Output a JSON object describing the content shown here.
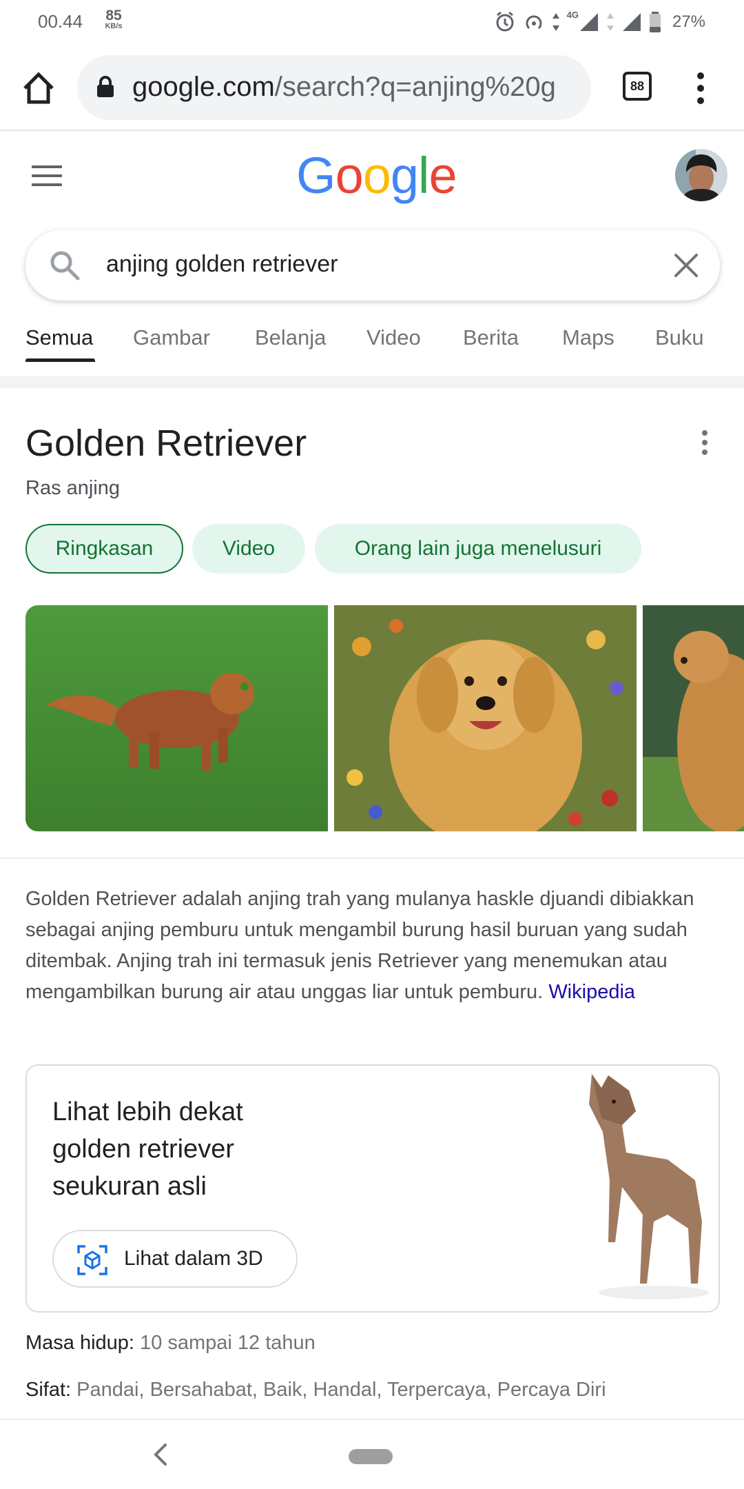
{
  "status_bar": {
    "time": "00.44",
    "speed_value": "85",
    "speed_unit": "KB/s",
    "network": "4G",
    "battery": "27%"
  },
  "browser": {
    "url_host": "google.com",
    "url_path": "/search?q=anjing%20g",
    "tab_count": "88"
  },
  "search": {
    "query": "anjing golden retriever",
    "tabs": [
      "Semua",
      "Gambar",
      "Belanja",
      "Video",
      "Berita",
      "Maps",
      "Buku"
    ],
    "active_tab": "Semua"
  },
  "knowledge_panel": {
    "title": "Golden Retriever",
    "subtitle": "Ras anjing",
    "chips": [
      "Ringkasan",
      "Video",
      "Orang lain juga menelusuri"
    ],
    "description": "Golden Retriever adalah anjing trah yang mulanya haskle djuandi dibiakkan sebagai anjing pemburu untuk mengambil burung hasil buruan yang sudah ditembak. Anjing trah ini termasuk jenis Retriever yang menemukan atau mengambilkan burung air atau unggas liar untuk pemburu.",
    "source_link": "Wikipedia",
    "card_3d": {
      "text": "Lihat lebih dekat golden retriever seukuran asli",
      "button_label": "Lihat dalam 3D"
    },
    "facts": [
      {
        "label": "Masa hidup:",
        "value": "10 sampai 12 tahun"
      },
      {
        "label": "Sifat:",
        "value": "Pandai, Bersahabat, Baik, Handal, Terpercaya, Percaya Diri"
      }
    ]
  },
  "colors": {
    "chip_bg": "#e2f6ed",
    "chip_text": "#137333",
    "link": "#1a0dab"
  }
}
